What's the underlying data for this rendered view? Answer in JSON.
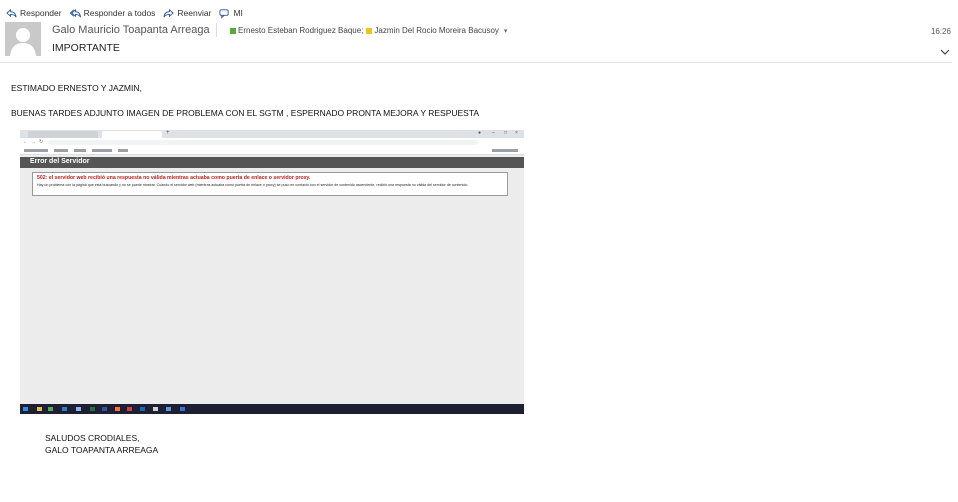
{
  "toolbar": {
    "reply": "Responder",
    "reply_all": "Responder a todos",
    "forward": "Reenviar",
    "im": "MI"
  },
  "header": {
    "sender": "Galo Mauricio Toapanta Arreaga",
    "recipients": [
      {
        "name": "Ernesto Esteban Rodriguez Baque;",
        "color": "#5aa83c"
      },
      {
        "name": "Jazmin Del Rocio Moreira Bacusoy",
        "color": "#f1c21b"
      }
    ],
    "time": "16:26",
    "subject": "IMPORTANTE"
  },
  "body": {
    "greeting": "ESTIMADO ERNESTO Y JAZMIN,",
    "message": "BUENAS TARDES ADJUNTO IMAGEN DE PROBLEMA CON EL SGTM , ESPERNADO PRONTA MEJORA Y RESPUESTA",
    "signature_line1": "SALUDOS CRODIALES,",
    "signature_line2": "GALO TOAPANTA ARREAGA"
  },
  "attachment_screenshot": {
    "page_title": "Error del Servidor",
    "error_heading": "502: el servidor web recibió una respuesta no válida mientras actuaba como puerta de enlace o servidor proxy.",
    "error_description": "Hay un problema con la página que está buscando y no se puede mostrar. Cuando el servidor web (mientras actuaba como puerta de enlace o proxy) se puso en contacto con el servidor de contenido ascendente, recibió una respuesta no válida del servidor de contenido."
  },
  "colors": {
    "error_red": "#c02020",
    "error_title_bar": "#555555"
  }
}
